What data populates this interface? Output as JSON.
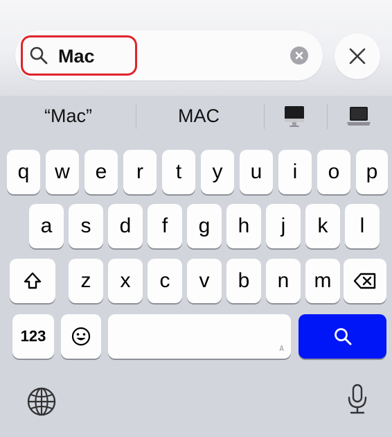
{
  "search": {
    "query": "Mac",
    "clear_icon": "clear-circle-icon",
    "close_icon": "close-x-icon"
  },
  "suggestions": {
    "quoted": "“Mac”",
    "upper": "MAC",
    "emoji_1": "desktop-computer-emoji",
    "emoji_2": "laptop-emoji"
  },
  "keyboard": {
    "row1": [
      "q",
      "w",
      "e",
      "r",
      "t",
      "y",
      "u",
      "i",
      "o",
      "p"
    ],
    "row2": [
      "a",
      "s",
      "d",
      "f",
      "g",
      "h",
      "j",
      "k",
      "l"
    ],
    "row3": [
      "z",
      "x",
      "c",
      "v",
      "b",
      "n",
      "m"
    ],
    "numbers_key": "123",
    "space_hint": "A",
    "shift_icon": "shift-arrow-icon",
    "delete_icon": "backspace-icon",
    "emoji_icon": "emoji-face-icon",
    "search_icon": "search-icon",
    "globe_icon": "globe-icon",
    "mic_icon": "microphone-icon"
  },
  "colors": {
    "keyboard_bg": "#d3d5dd",
    "search_key": "#0016f6",
    "highlight": "#e0232b"
  }
}
